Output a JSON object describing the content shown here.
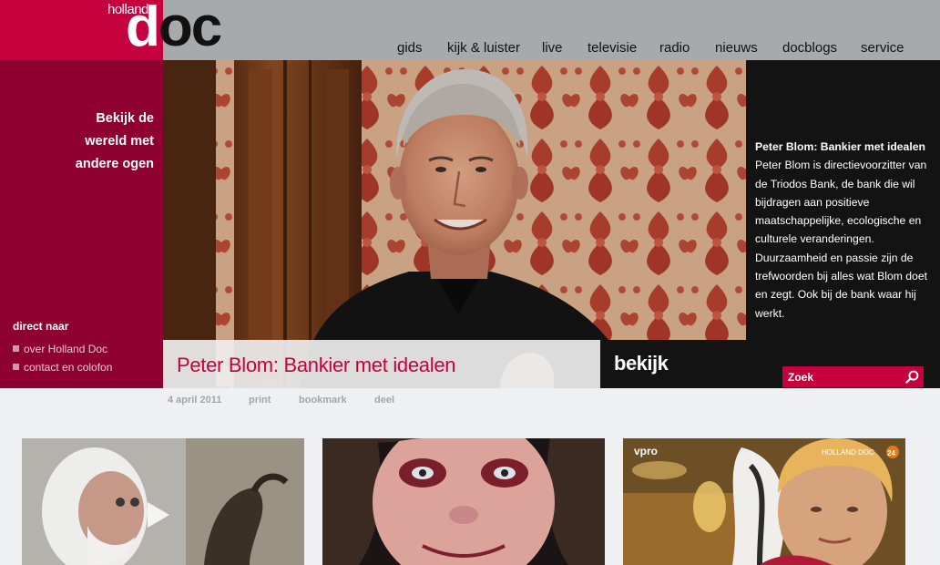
{
  "logo": {
    "holland": "holland",
    "d": "d",
    "oc": "oc"
  },
  "nav": [
    "gids",
    "kijk & luister",
    "live",
    "televisie",
    "radio",
    "nieuws",
    "docblogs",
    "service"
  ],
  "sidebar": {
    "tagline": [
      "Bekijk de",
      "wereld met",
      "andere ogen"
    ],
    "direct_title": "direct naar",
    "links": [
      "over Holland Doc",
      "contact en colofon"
    ]
  },
  "hero": {
    "caption": "Peter Blom: Bankier met idealen",
    "watch_label": "bekijk"
  },
  "description": {
    "title": "Peter Blom: Bankier met idealen",
    "text": "Peter Blom is directievoorzitter van de Triodos Bank, de bank die wil bijdragen aan positieve maatschappelijke, ecologische en culturele veranderingen. Duurzaamheid en passie zijn de trefwoorden bij alles wat Blom doet en zegt. Ook bij de bank waar hij werkt."
  },
  "search": {
    "placeholder": "Zoek",
    "icon": "search-icon"
  },
  "meta": {
    "date": "4 april 2011",
    "print": "print",
    "bookmark": "bookmark",
    "share": "deel"
  },
  "thumbnails": {
    "third_left_logo": "vpro",
    "third_right_logo": "HOLLAND DOC",
    "third_badge": "24"
  },
  "colors": {
    "brand": "#c6023e",
    "sidebar": "#8d0030",
    "topbar": "#a7aaac",
    "dark": "#131313"
  }
}
